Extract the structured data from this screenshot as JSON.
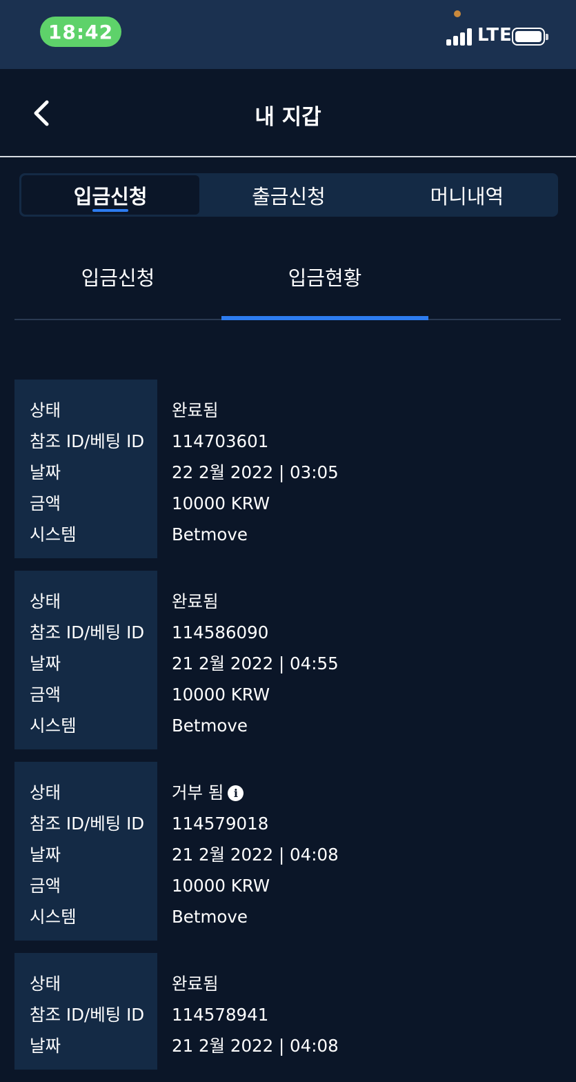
{
  "status_bar": {
    "time": "18:42",
    "network": "LTE",
    "camera_dot_color": "#c9893c"
  },
  "header": {
    "title": "내 지갑"
  },
  "tabs": [
    {
      "label": "입금신청",
      "active": true
    },
    {
      "label": "출금신청",
      "active": false
    },
    {
      "label": "머니내역",
      "active": false
    }
  ],
  "subtabs": [
    {
      "label": "입금신청",
      "active": false
    },
    {
      "label": "입금현황",
      "active": true
    }
  ],
  "labels": {
    "status": "상태",
    "ref_id": "참조 ID/베팅 ID",
    "date": "날짜",
    "amount": "금액",
    "system": "시스템"
  },
  "transactions": [
    {
      "status": "완료됨",
      "ref_id": "114703601",
      "date": "22 2월 2022 | 03:05",
      "amount": "10000 KRW",
      "system": "Betmove"
    },
    {
      "status": "완료됨",
      "ref_id": "114586090",
      "date": "21 2월 2022 | 04:55",
      "amount": "10000 KRW",
      "system": "Betmove"
    },
    {
      "status": "거부 됨",
      "ref_id": "114579018",
      "date": "21 2월 2022 | 04:08",
      "amount": "10000 KRW",
      "system": "Betmove",
      "has_info_icon": true
    },
    {
      "status": "완료됨",
      "ref_id": "114578941",
      "date": "21 2월 2022 | 04:08"
    }
  ],
  "colors": {
    "background": "#0b1628",
    "panel": "#142a45",
    "accent": "#2d7cf0",
    "time_pill": "#5ed26a"
  }
}
